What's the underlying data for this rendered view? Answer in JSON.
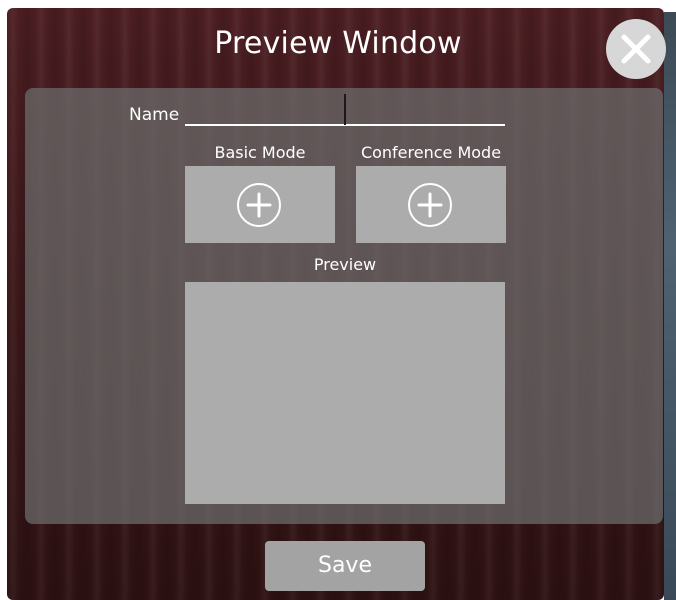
{
  "dialog": {
    "title": "Preview Window",
    "close_icon": "close-icon"
  },
  "form": {
    "name_label": "Name",
    "name_value": "",
    "name_placeholder": ""
  },
  "modes": {
    "basic_label": "Basic Mode",
    "conference_label": "Conference Mode",
    "add_icon": "plus-circle-icon"
  },
  "preview": {
    "label": "Preview"
  },
  "actions": {
    "save_label": "Save"
  },
  "colors": {
    "background_maroon": "#3a1719",
    "panel_gray": "#6e6e6e",
    "box_gray": "#acacac",
    "button_gray": "#a3a3a3",
    "text": "#ffffff"
  }
}
